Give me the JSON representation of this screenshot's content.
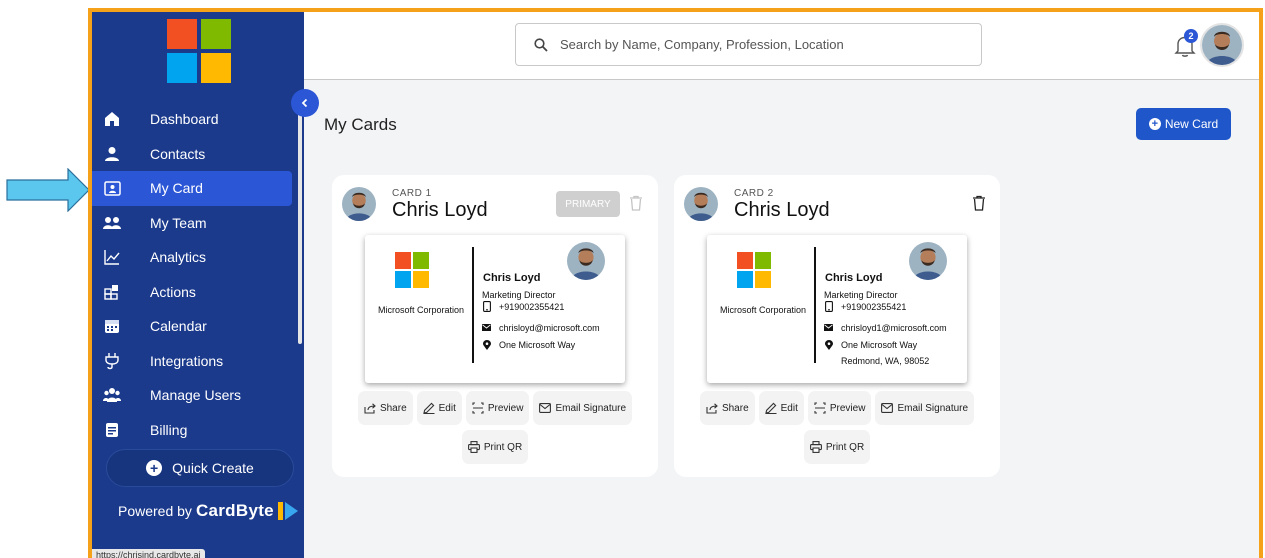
{
  "colors": {
    "sidebar": "#1b3a8c",
    "accent": "#2b56d6",
    "frame": "#f5a21a",
    "ms_red": "#f25022",
    "ms_green": "#7fba00",
    "ms_blue": "#00a4ef",
    "ms_yellow": "#ffb900"
  },
  "sidebar": {
    "items": [
      {
        "label": "Dashboard",
        "icon": "home-icon"
      },
      {
        "label": "Contacts",
        "icon": "person-icon"
      },
      {
        "label": "My Card",
        "icon": "id-card-icon",
        "active": true
      },
      {
        "label": "My Team",
        "icon": "team-icon"
      },
      {
        "label": "Analytics",
        "icon": "chart-icon"
      },
      {
        "label": "Actions",
        "icon": "actions-icon"
      },
      {
        "label": "Calendar",
        "icon": "calendar-icon"
      },
      {
        "label": "Integrations",
        "icon": "plug-icon"
      },
      {
        "label": "Manage Users",
        "icon": "users-icon"
      },
      {
        "label": "Billing",
        "icon": "billing-icon"
      }
    ],
    "quick_create": "Quick Create",
    "powered_by": "Powered by",
    "brand": "CardByte"
  },
  "status_url": "https://chrisind.cardbyte.ai",
  "header": {
    "search_placeholder": "Search by Name, Company, Profession, Location",
    "notification_count": "2"
  },
  "main": {
    "title": "My Cards",
    "new_card": "New Card",
    "cards": [
      {
        "num": "CARD 1",
        "owner": "Chris Loyd",
        "primary": "PRIMARY",
        "company": "Microsoft Corporation",
        "name": "Chris Loyd",
        "title": "Marketing Director",
        "phone": "+919002355421",
        "email": "chrisloyd@microsoft.com",
        "address1": "One Microsoft Way",
        "address2": ""
      },
      {
        "num": "CARD 2",
        "owner": "Chris Loyd",
        "company": "Microsoft Corporation",
        "name": "Chris Loyd",
        "title": "Marketing Director",
        "phone": "+919002355421",
        "email": "chrisloyd1@microsoft.com",
        "address1": "One Microsoft Way",
        "address2": "Redmond, WA, 98052"
      }
    ],
    "actions": {
      "share": "Share",
      "edit": "Edit",
      "preview": "Preview",
      "email_signature": "Email Signature",
      "print_qr": "Print QR"
    }
  }
}
